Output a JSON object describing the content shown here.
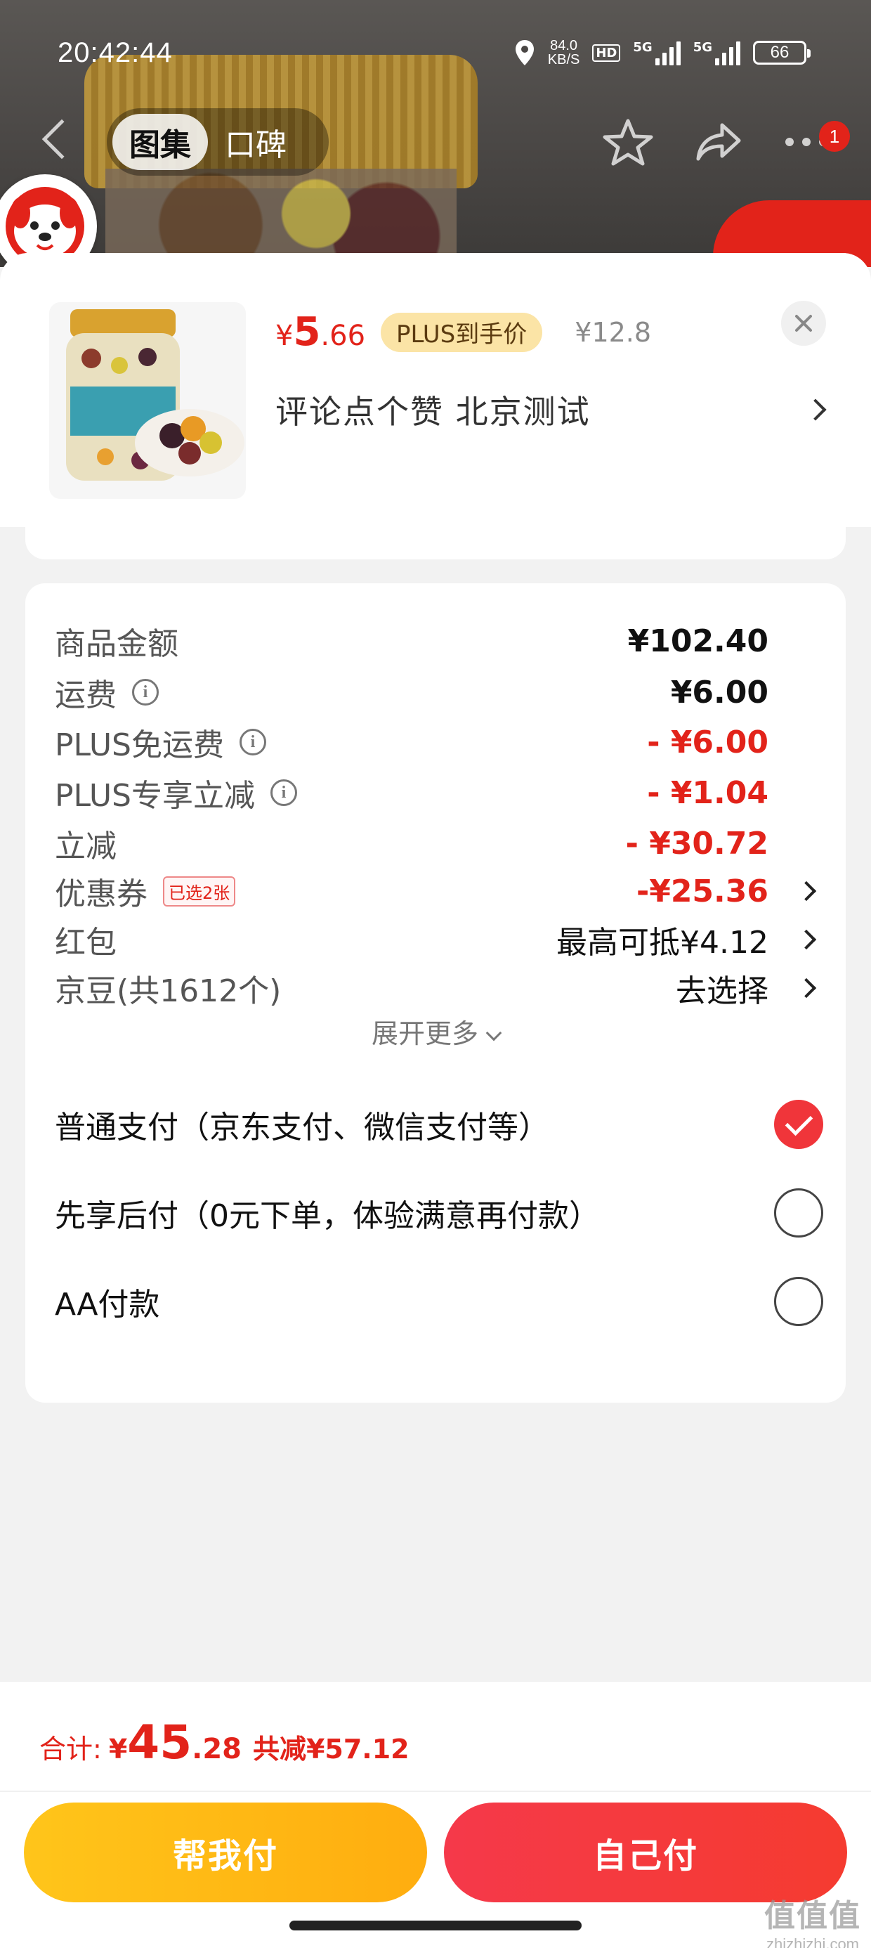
{
  "status_bar": {
    "time": "20:42:44",
    "net_speed_value": "84.0",
    "net_speed_unit": "KB/S",
    "hd_tag": "HD",
    "sig1_label": "5G",
    "sig2_label": "5G",
    "battery": "66"
  },
  "nav": {
    "tabs": [
      {
        "label": "图集",
        "active": true
      },
      {
        "label": "口碑",
        "active": false
      }
    ],
    "more_badge": "1"
  },
  "product": {
    "price_symbol": "¥",
    "price_int": "5",
    "price_dec": ".66",
    "plus_tag": "PLUS到手价",
    "original_price": "¥12.8",
    "description": "评论点个赞  北京测试"
  },
  "cost_breakdown": {
    "rows": [
      {
        "label": "商品金额",
        "value": "¥102.40",
        "info": false,
        "style": "bold"
      },
      {
        "label": "运费",
        "value": "¥6.00",
        "info": true,
        "style": "bold"
      },
      {
        "label": "PLUS免运费",
        "value": "- ¥6.00",
        "info": true,
        "style": "red"
      },
      {
        "label": "PLUS专享立减",
        "value": "- ¥1.04",
        "info": true,
        "style": "red"
      },
      {
        "label": "立减",
        "value": "- ¥30.72",
        "info": false,
        "style": "red"
      },
      {
        "label": "优惠券",
        "tag": "已选2张",
        "value": "-¥25.36",
        "info": false,
        "style": "red",
        "chevron": true
      },
      {
        "label": "红包",
        "value": "最高可抵¥4.12",
        "info": false,
        "style": "normal",
        "chevron": true
      },
      {
        "label": "京豆(共1612个)",
        "value": "去选择",
        "info": false,
        "style": "normal",
        "chevron": true
      }
    ],
    "expand_label": "展开更多"
  },
  "payment_options": [
    {
      "label": "普通支付（京东支付、微信支付等）",
      "selected": true
    },
    {
      "label": "先享后付（0元下单，体验满意再付款）",
      "selected": false
    },
    {
      "label": "AA付款",
      "selected": false
    }
  ],
  "footer": {
    "total_label": "合计:",
    "total_symbol": "¥",
    "total_int": "45",
    "total_dec": ".28",
    "saved_text": "共减¥57.12",
    "help_pay_button": "帮我付",
    "self_pay_button": "自己付"
  },
  "watermark": {
    "glyphs": "值值值",
    "site": "zhizhizhi.com"
  },
  "colors": {
    "accent_red": "#e2231a",
    "help_button": "#ffb714",
    "self_button": "#f53a3c",
    "plus_tag_bg": "#fbe4a6"
  }
}
